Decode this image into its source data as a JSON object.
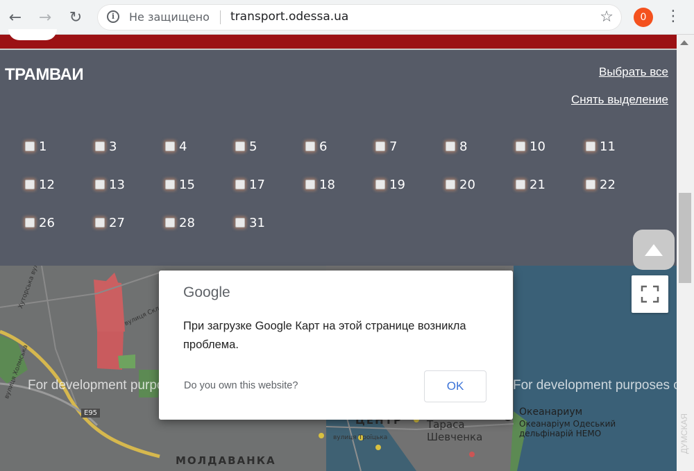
{
  "browser": {
    "security_label": "Не защищено",
    "url": "transport.odessa.ua",
    "extension_badge": "0"
  },
  "panel": {
    "title": "ТРАМВАИ",
    "select_all": "Выбрать все",
    "deselect": "Снять выделение",
    "routes": [
      "1",
      "3",
      "4",
      "5",
      "6",
      "7",
      "8",
      "10",
      "11",
      "12",
      "13",
      "15",
      "17",
      "18",
      "19",
      "20",
      "21",
      "22",
      "26",
      "27",
      "28",
      "31"
    ]
  },
  "map": {
    "dev_watermark_left": "For development purposes only",
    "dev_watermark_right": "For development purposes only",
    "district_center": "ЦЕНТР",
    "district_moldavanka": "МОЛДАВАНКА",
    "place_shevchenko": "Тараса Шевченка",
    "place_oceanarium": "Океанариум",
    "place_oceanarium_sub": "Океанаріум Одеський дельфінарій НЕМО",
    "street_troitska": "вулиця Троїцька",
    "street_khutorska": "Хуторська вулиця",
    "street_kholmska": "вулиця Холмська",
    "street_sklyarska": "вулиця Скл...",
    "road_e95": "E95"
  },
  "dialog": {
    "logo": "Google",
    "message": "При загрузке Google Карт на этой странице возникла проблема.",
    "question": "Do you own this website?",
    "ok": "OK"
  },
  "colors": {
    "header_red": "#9b1114",
    "panel_bg": "#565b67",
    "link_blue": "#3c74d8",
    "extension_orange": "#f4511e"
  },
  "watermark": "ДУМСКАЯ"
}
